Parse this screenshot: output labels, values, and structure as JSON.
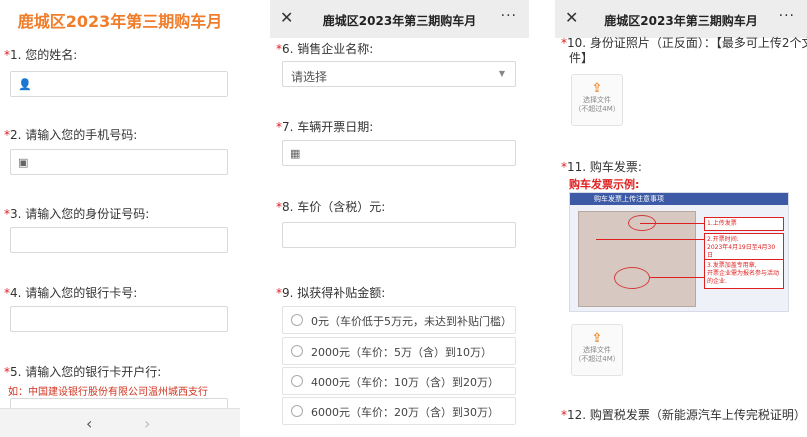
{
  "form_title": "鹿城区2023年第三期购车月",
  "topbar": {
    "close_icon": "close-icon",
    "title": "鹿城区2023年第三期购车月",
    "more": "···"
  },
  "panel1": {
    "questions": [
      {
        "star": "*",
        "label": "1. 您的姓名:",
        "icon": "👤"
      },
      {
        "star": "*",
        "label": "2. 请输入您的手机号码:",
        "icon": "▣"
      },
      {
        "star": "*",
        "label": "3. 请输入您的身份证号码:",
        "icon": ""
      },
      {
        "star": "*",
        "label": "4. 请输入您的银行卡号:",
        "icon": ""
      },
      {
        "star": "*",
        "label": "5. 请输入您的银行卡开户行:",
        "icon": ""
      }
    ],
    "hint5": "如：中国建设银行股份有限公司温州城西支行",
    "nav_back": "‹",
    "nav_forward": "›"
  },
  "panel2": {
    "q6": {
      "star": "*",
      "label": "6. 销售企业名称:",
      "select_value": "请选择"
    },
    "q7": {
      "star": "*",
      "label": "7. 车辆开票日期:"
    },
    "q8": {
      "star": "*",
      "label": "8. 车价（含税）元:"
    },
    "q9": {
      "star": "*",
      "label": "9. 拟获得补贴金额:",
      "options": [
        "0元（车价低于5万元，未达到补贴门槛）",
        "2000元（车价：5万（含）到10万）",
        "4000元（车价：10万（含）到20万）",
        "6000元（车价：20万（含）到30万）"
      ]
    }
  },
  "panel3": {
    "q10": {
      "star": "*",
      "label": "10. 身份证照片（正反面）：【最多可上传2个文",
      "label_cont": "件】"
    },
    "upload": {
      "icon": "⇪",
      "line1": "选择文件",
      "line2": "（不超过4M）"
    },
    "q11": {
      "star": "*",
      "label": "11. 购车发票:"
    },
    "sample_title": "购车发票示例:",
    "invoice": {
      "header": "购车发票上传注意事项",
      "note1": "1.上传发票",
      "note2": "2.开票时间:\n2023年4月19日至4月30日",
      "note3": "3.发票加盖专用章,\n开票企业需为报名参与活动的企业."
    },
    "q12": {
      "star": "*",
      "label": "12. 购置税发票（新能源汽车上传完税证明）:"
    }
  }
}
